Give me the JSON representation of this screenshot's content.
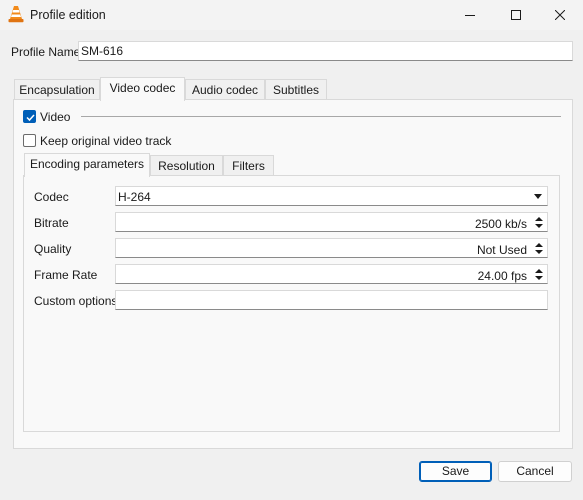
{
  "window": {
    "title": "Profile edition",
    "controls": [
      "minimize-icon",
      "maximize-icon",
      "close-icon"
    ]
  },
  "profile": {
    "label": "Profile Name",
    "value": "SM-616"
  },
  "tabs": [
    {
      "label": "Encapsulation",
      "active": false
    },
    {
      "label": "Video codec",
      "active": true
    },
    {
      "label": "Audio codec",
      "active": false
    },
    {
      "label": "Subtitles",
      "active": false
    }
  ],
  "video": {
    "video_checkbox": {
      "label": "Video",
      "checked": true
    },
    "keep_original": {
      "label": "Keep original video track",
      "checked": false
    }
  },
  "subtabs": [
    {
      "label": "Encoding parameters",
      "active": true
    },
    {
      "label": "Resolution",
      "active": false
    },
    {
      "label": "Filters",
      "active": false
    }
  ],
  "fields": {
    "codec": {
      "label": "Codec",
      "value": "H-264"
    },
    "bitrate": {
      "label": "Bitrate",
      "value": "2500 kb/s"
    },
    "quality": {
      "label": "Quality",
      "value": "Not Used"
    },
    "frame_rate": {
      "label": "Frame Rate",
      "value": "24.00 fps"
    },
    "custom_options": {
      "label": "Custom options",
      "value": ""
    }
  },
  "buttons": {
    "save": "Save",
    "cancel": "Cancel"
  },
  "colors": {
    "accent": "#005fb8",
    "icon_orange": "#f28a1a"
  }
}
